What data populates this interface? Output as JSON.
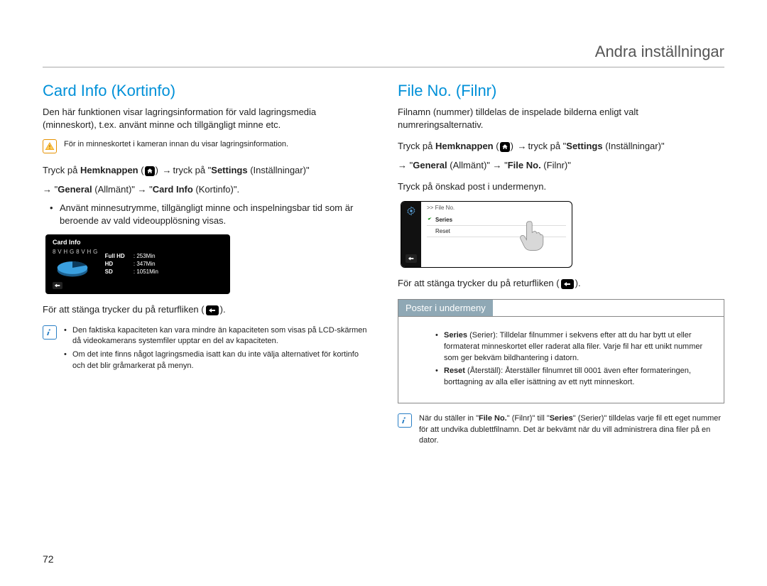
{
  "header": {
    "title": "Andra inställningar"
  },
  "page_number": "72",
  "left": {
    "title": "Card Info (Kortinfo)",
    "desc": "Den här funktionen visar lagringsinformation för vald lagringsmedia (minneskort), t.ex. använt minne och tillgängligt minne etc.",
    "warn_note": "För in minneskortet i kameran innan du visar lagringsinformation.",
    "path_prefix": "Tryck på ",
    "path_home": "Hemknappen",
    "path_mid": " → tryck på \"",
    "path_settings": "Settings",
    "path_settings_sfx": " (Inställningar)\"",
    "path_line2_a": "→ \"",
    "path_general": "General",
    "path_general_sfx": " (Allmänt)\" → \"",
    "path_cardinfo": "Card Info",
    "path_cardinfo_sfx": " (Kortinfo)\".",
    "bullet": "Använt minnesutrymme, tillgängligt minne och inspelningsbar tid som är beroende av vald videoupplösning visas.",
    "screenshot": {
      "title": "Card Info",
      "used_text": "8 V H G 8 V H G",
      "row1_label": "Full HD",
      "row1_val": "253Min",
      "row2_label": "HD",
      "row2_val": "347Min",
      "row3_label": "SD",
      "row3_val": "1051Min"
    },
    "close_prefix": "För att stänga trycker du på returfliken (",
    "close_suffix": ").",
    "info_bullets": [
      "Den faktiska kapaciteten kan vara mindre än kapaciteten som visas på LCD-skärmen då videokamerans systemfiler upptar en del av kapaciteten.",
      "Om det inte finns något lagringsmedia isatt kan du inte välja alternativet för kortinfo och det blir gråmarkerat på menyn."
    ]
  },
  "right": {
    "title": "File No. (Filnr)",
    "desc": "Filnamn (nummer) tilldelas de inspelade bilderna enligt valt numreringsalternativ.",
    "path_prefix": "Tryck på ",
    "path_home": "Hemknappen",
    "path_mid": " → tryck på \"",
    "path_settings": "Settings",
    "path_settings_sfx": " (Inställningar)\"",
    "path_line2_a": "→ \"",
    "path_general": "General",
    "path_general_sfx": " (Allmänt)\" → \"",
    "path_fileno": "File No.",
    "path_fileno_sfx": " (Filnr)\"",
    "sub_intro": "Tryck på önskad post i undermenyn.",
    "screenshot": {
      "crumb": ">> File No.",
      "item1": "Series",
      "item2": "Reset"
    },
    "close_prefix": "För att stänga trycker du på returfliken (",
    "close_suffix": ").",
    "subbox_title": "Poster i undermeny",
    "sub_items": [
      {
        "head": "Series",
        "headsfx": " (Serier): ",
        "body": "Tilldelar filnummer i sekvens efter att du har bytt ut eller formaterat minneskortet eller raderat alla filer. Varje fil har ett unikt nummer som ger bekväm bildhantering i datorn."
      },
      {
        "head": "Reset",
        "headsfx": " (Återställ): ",
        "body": "Återställer filnumret till 0001 även efter formateringen, borttagning av alla eller isättning av ett nytt minneskort."
      }
    ],
    "info_note_a": "När du ställer in \"",
    "info_note_b": "File No.",
    "info_note_c": "\" (Filnr)\" till \"",
    "info_note_d": "Series",
    "info_note_e": "\" (Serier)\" tilldelas varje fil ett eget nummer för att undvika dublettfilnamn. Det är bekvämt när du vill administrera dina filer på en dator."
  }
}
